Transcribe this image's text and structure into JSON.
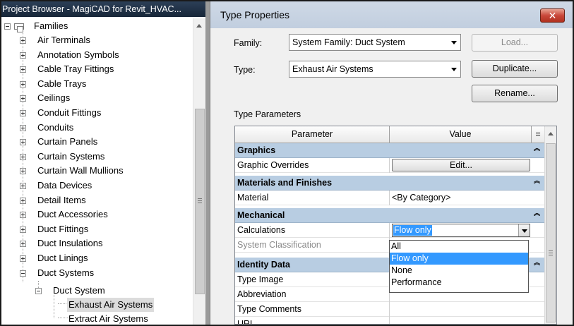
{
  "project_browser": {
    "title": "Project Browser - MagiCAD for Revit_HVAC...",
    "root_label": "Families",
    "items": [
      "Air Terminals",
      "Annotation Symbols",
      "Cable Tray Fittings",
      "Cable Trays",
      "Ceilings",
      "Conduit Fittings",
      "Conduits",
      "Curtain Panels",
      "Curtain Systems",
      "Curtain Wall Mullions",
      "Data Devices",
      "Detail Items",
      "Duct Accessories",
      "Duct Fittings",
      "Duct Insulations",
      "Duct Linings",
      "Duct Systems"
    ],
    "child_label": "Duct System",
    "grandchildren": [
      "Exhaust Air Systems",
      "Extract Air Systems"
    ],
    "selected": "Exhaust Air Systems"
  },
  "dialog": {
    "title": "Type Properties",
    "close_icon": "close-x-icon",
    "family_label": "Family:",
    "family_value": "System Family: Duct System",
    "type_label": "Type:",
    "type_value": "Exhaust Air Systems",
    "load_button": "Load...",
    "duplicate_button": "Duplicate...",
    "rename_button": "Rename...",
    "type_parameters_label": "Type Parameters",
    "table": {
      "col_parameter": "Parameter",
      "col_value": "Value",
      "col_extra": "="
    },
    "groups": {
      "graphics": "Graphics",
      "materials": "Materials and Finishes",
      "mechanical": "Mechanical",
      "identity": "Identity Data"
    },
    "rows": {
      "graphic_overrides": "Graphic Overrides",
      "graphic_overrides_button": "Edit...",
      "material": "Material",
      "material_value": "<By Category>",
      "calculations": "Calculations",
      "calculations_value": "Flow only",
      "system_classification": "System Classification",
      "type_image": "Type Image",
      "abbreviation": "Abbreviation",
      "type_comments": "Type Comments",
      "url": "URL"
    },
    "calculation_options": [
      "All",
      "Flow only",
      "None",
      "Performance"
    ],
    "highlighted_option": "Flow only"
  },
  "colors": {
    "group_header_bg": "#b8cde2",
    "selection_blue": "#3399ff",
    "close_button_red": "#c9483a",
    "browser_title_bg": "#1f3047"
  }
}
